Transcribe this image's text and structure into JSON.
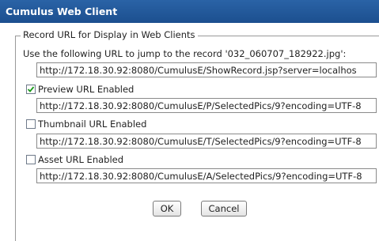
{
  "window": {
    "title": "Cumulus Web Client"
  },
  "group": {
    "legend": "Record URL for Display in Web Clients"
  },
  "intro_text": "Use the following URL to jump to the record '032_060707_182922.jpg':",
  "record_url": {
    "value": "http://172.18.30.92:8080/CumulusE/ShowRecord.jsp?server=localhos"
  },
  "preview": {
    "label": "Preview URL Enabled",
    "checked": true,
    "url": "http://172.18.30.92:8080/CumulusE/P/SelectedPics/9?encoding=UTF-8"
  },
  "thumbnail": {
    "label": "Thumbnail URL Enabled",
    "checked": false,
    "url": "http://172.18.30.92:8080/CumulusE/T/SelectedPics/9?encoding=UTF-8"
  },
  "asset": {
    "label": "Asset URL Enabled",
    "checked": false,
    "url": "http://172.18.30.92:8080/CumulusE/A/SelectedPics/9?encoding=UTF-8"
  },
  "buttons": {
    "ok": "OK",
    "cancel": "Cancel"
  }
}
